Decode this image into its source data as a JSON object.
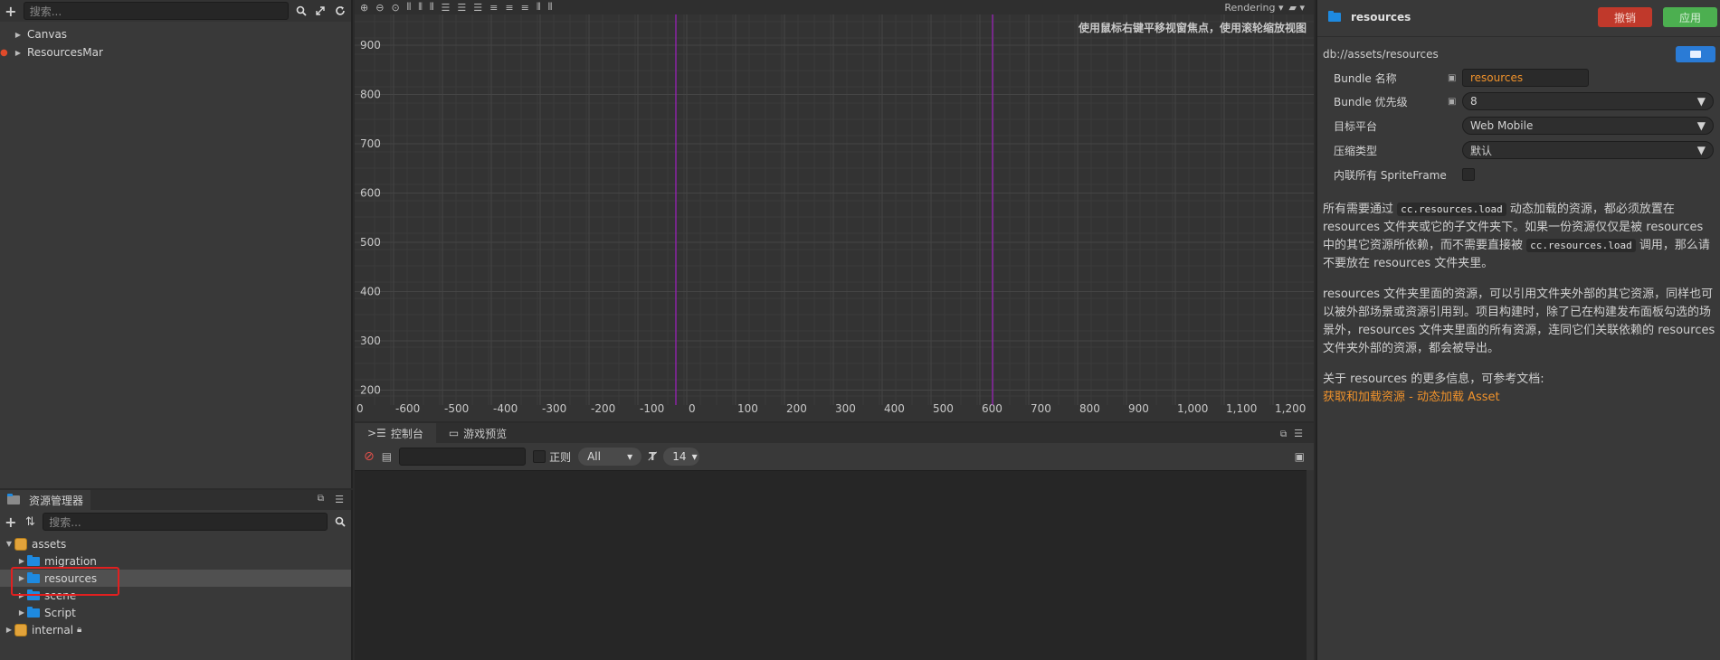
{
  "hierarchy": {
    "search_placeholder": "搜索...",
    "nodes": [
      {
        "label": "Canvas"
      },
      {
        "label": "ResourcesMar"
      }
    ]
  },
  "scene": {
    "toolbar": {
      "rendering": "Rendering"
    },
    "hint": "使用鼠标右键平移视窗焦点，使用滚轮缩放视图",
    "y_ticks": [
      "900",
      "800",
      "700",
      "600",
      "500",
      "400",
      "300",
      "200"
    ],
    "x_ticks": [
      "0",
      "-600",
      "-500",
      "-400",
      "-300",
      "-200",
      "-100",
      "0",
      "100",
      "200",
      "300",
      "400",
      "500",
      "600",
      "700",
      "800",
      "900",
      "1,000",
      "1,100",
      "1,200"
    ]
  },
  "console": {
    "tabs": [
      "控制台",
      "游戏预览"
    ],
    "regex_label": "正则",
    "level_select": "All",
    "font_size": "14"
  },
  "assets": {
    "tab_label": "资源管理器",
    "search_placeholder": "搜索...",
    "tree": [
      {
        "label": "assets"
      },
      {
        "label": "migration"
      },
      {
        "label": "resources"
      },
      {
        "label": "scene"
      },
      {
        "label": "Script"
      },
      {
        "label": "internal"
      }
    ],
    "highlight_color": "#e02020"
  },
  "inspector": {
    "title": "resources",
    "revert_label": "撤销",
    "apply_label": "应用",
    "path": "db://assets/resources",
    "props": [
      {
        "label": "Bundle 名称",
        "value": "resources"
      },
      {
        "label": "Bundle 优先级",
        "value": "8"
      },
      {
        "label": "目标平台",
        "value": "Web Mobile"
      },
      {
        "label": "压缩类型",
        "value": "默认"
      },
      {
        "label": "内联所有 SpriteFrame",
        "value": ""
      }
    ],
    "para1": {
      "t1": "所有需要通过",
      "code1": "cc.resources.load",
      "t2": "动态加载的资源，都必须放置在 resources 文件夹或它的子文件夹下。如果一份资源仅仅是被 resources 中的其它资源所依赖，而不需要直接被",
      "code2": "cc.resources.load",
      "t3": "调用，那么请不要放在 resources 文件夹里。"
    },
    "para2": "resources 文件夹里面的资源，可以引用文件夹外部的其它资源，同样也可以被外部场景或资源引用到。项目构建时，除了已在构建发布面板勾选的场景外，resources 文件夹里面的所有资源，连同它们关联依赖的 resources 文件夹外部的资源，都会被导出。",
    "para3": "关于 resources 的更多信息，可参考文档:",
    "link": "获取和加载资源 - 动态加载 Asset",
    "colors": {
      "revert": "#c0392b",
      "apply": "#4caf50",
      "link": "#f0922b",
      "value": "#f0922b"
    }
  }
}
